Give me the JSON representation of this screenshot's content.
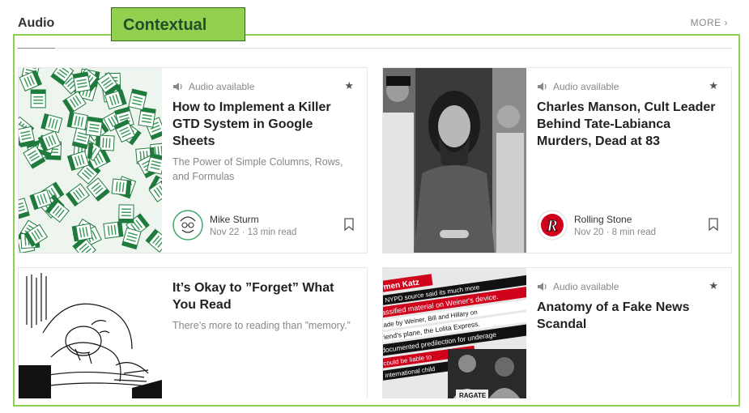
{
  "section": {
    "title": "Audio",
    "more_label": "MORE"
  },
  "overlay": {
    "label": "Contextual"
  },
  "cards": [
    {
      "audio_label": "Audio available",
      "title": "How to Implement a Killer GTD System in Google Sheets",
      "subtitle": "The Power of Simple Columns, Rows, and Formulas",
      "author": "Mike Sturm",
      "date": "Nov 22",
      "read_time": "13 min read"
    },
    {
      "audio_label": "Audio available",
      "title": "Charles Manson, Cult Leader Behind Tate-Labianca Murders, Dead at 83",
      "author": "Rolling Stone",
      "date": "Nov 20",
      "read_time": "8 min read"
    },
    {
      "title": "It’s Okay to ”Forget” What You Read",
      "subtitle": "There’s more to reading than ”memory.”"
    },
    {
      "audio_label": "Audio available",
      "title": "Anatomy of a Fake News Scandal",
      "collage_text": [
        "armen Katz",
        "My NYPD source said its much more",
        "classified material on Weiner's device.",
        "made by Weiner, Bill and Hillary on",
        "friend's plane, the Lolita Express.",
        "documented predilection for underage",
        "could be liable to",
        "international child",
        "RAGATE"
      ]
    }
  ],
  "colors": {
    "accent_green": "#92d050",
    "sheet_green": "#1f7a3d"
  }
}
